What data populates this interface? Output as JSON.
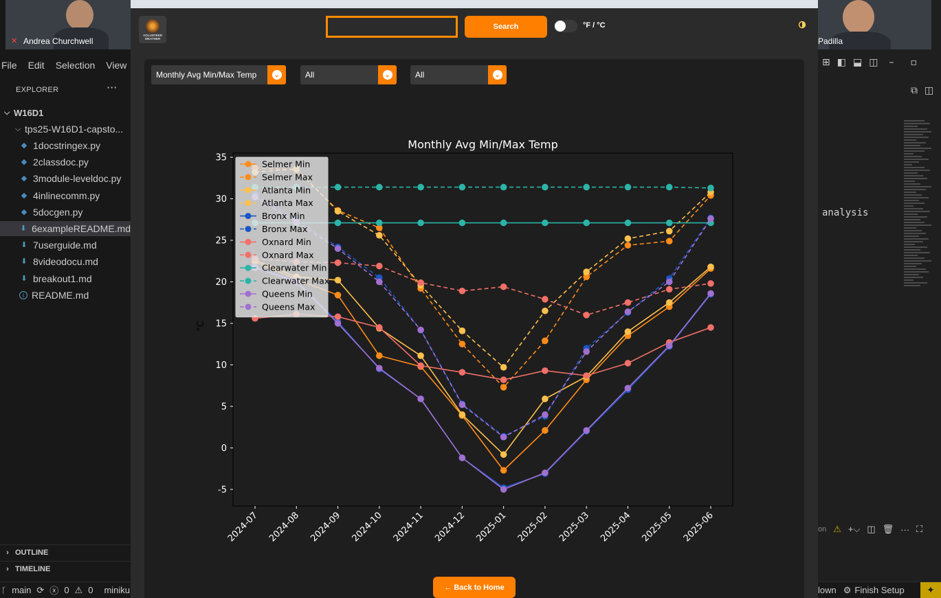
{
  "meeting": {
    "participant_left": "Andrea Churchwell",
    "participant_right": "Padilla"
  },
  "vscode": {
    "menu": [
      "File",
      "Edit",
      "Selection",
      "View"
    ],
    "explorer_title": "EXPLORER",
    "workspace": "W16D1",
    "folder": "tps25-W16D1-capsto...",
    "files": [
      {
        "name": "1docstringex.py",
        "kind": "py"
      },
      {
        "name": "2classdoc.py",
        "kind": "py"
      },
      {
        "name": "3module-leveldoc.py",
        "kind": "py"
      },
      {
        "name": "4inlinecomm.py",
        "kind": "py"
      },
      {
        "name": "5docgen.py",
        "kind": "py"
      },
      {
        "name": "6exampleREADME.md",
        "kind": "md"
      },
      {
        "name": "7userguide.md",
        "kind": "md"
      },
      {
        "name": "8videodocu.md",
        "kind": "md"
      },
      {
        "name": "breakout1.md",
        "kind": "md"
      },
      {
        "name": "README.md",
        "kind": "info"
      }
    ],
    "outline_label": "OUTLINE",
    "timeline_label": "TIMELINE",
    "status": {
      "branch": "main",
      "errors": "0",
      "warnings": "0",
      "extra": "miniku"
    },
    "editor_text": "analysis",
    "right_status": {
      "down": "lown",
      "finish_setup": "Finish Setup",
      "partial": "on"
    }
  },
  "app": {
    "logo_text": "VOLUNTEER WEATHER",
    "search": {
      "value": "",
      "button": "Search"
    },
    "unit_toggle_label": "°F / °C",
    "selects": [
      {
        "value": "Monthly Avg Min/Max Temp"
      },
      {
        "value": "All"
      },
      {
        "value": "All"
      }
    ],
    "back_button": "← Back to Home",
    "colors": {
      "accent": "#ff7f00",
      "background": "#1e1e1e"
    }
  },
  "chart_data": {
    "type": "line",
    "title": "Monthly Avg Min/Max Temp",
    "xlabel": "",
    "ylabel": "°C",
    "ylim": [
      -7,
      35.5
    ],
    "yticks": [
      -5,
      0,
      5,
      10,
      15,
      20,
      25,
      30,
      35
    ],
    "grid": false,
    "legend_placement": "top-left",
    "categories": [
      "2024-07",
      "2024-08",
      "2024-09",
      "2024-10",
      "2024-11",
      "2024-12",
      "2025-01",
      "2025-02",
      "2025-03",
      "2025-04",
      "2025-05",
      "2025-06"
    ],
    "series": [
      {
        "name": "Selmer Min",
        "color": "#ff8c1a",
        "style": "solid",
        "values": [
          22.4,
          20.3,
          18.4,
          11.1,
          9.8,
          3.9,
          -2.7,
          2.1,
          8.2,
          13.5,
          17.0,
          21.6
        ]
      },
      {
        "name": "Selmer Max",
        "color": "#ff8c1a",
        "style": "dashed",
        "values": [
          33.7,
          33.5,
          28.6,
          26.5,
          19.2,
          12.5,
          7.3,
          12.9,
          20.6,
          24.4,
          24.9,
          30.4
        ]
      },
      {
        "name": "Atlanta Min",
        "color": "#ffc04d",
        "style": "solid",
        "values": [
          22.6,
          20.6,
          20.2,
          14.4,
          11.1,
          4.0,
          -0.8,
          5.9,
          8.6,
          14.0,
          17.5,
          21.8
        ]
      },
      {
        "name": "Atlanta Max",
        "color": "#ffc04d",
        "style": "dashed",
        "values": [
          33.2,
          33.6,
          28.5,
          25.6,
          19.6,
          14.1,
          9.7,
          16.5,
          21.2,
          25.2,
          26.1,
          30.8
        ]
      },
      {
        "name": "Bronx Min",
        "color": "#1a56c4",
        "style": "solid",
        "values": [
          21.8,
          20.1,
          15.2,
          9.5,
          5.9,
          -1.2,
          -4.8,
          -3.1,
          2.0,
          7.0,
          12.2,
          18.5
        ]
      },
      {
        "name": "Bronx Max",
        "color": "#1a56c4",
        "style": "dashed",
        "values": [
          30.5,
          27.5,
          24.2,
          20.5,
          14.2,
          5.3,
          1.4,
          3.8,
          12.0,
          16.3,
          20.4,
          27.7
        ]
      },
      {
        "name": "Oxnard Min",
        "color": "#f27068",
        "style": "solid",
        "values": [
          15.6,
          16.1,
          15.8,
          14.5,
          9.9,
          9.1,
          8.2,
          9.3,
          8.7,
          10.2,
          12.7,
          14.5
        ]
      },
      {
        "name": "Oxnard Max",
        "color": "#f27068",
        "style": "dashed",
        "values": [
          22.8,
          22.4,
          22.3,
          21.9,
          19.9,
          18.9,
          19.4,
          17.9,
          16.0,
          17.5,
          19.1,
          19.8
        ]
      },
      {
        "name": "Clearwater Min",
        "color": "#2bb5a8",
        "style": "solid",
        "values": [
          27.1,
          27.1,
          27.1,
          27.1,
          27.1,
          27.1,
          27.1,
          27.1,
          27.1,
          27.1,
          27.1,
          27.1
        ]
      },
      {
        "name": "Clearwater Max",
        "color": "#2bb5a8",
        "style": "dashed",
        "values": [
          31.4,
          31.4,
          31.4,
          31.4,
          31.4,
          31.4,
          31.4,
          31.4,
          31.4,
          31.4,
          31.4,
          31.3
        ]
      },
      {
        "name": "Queens Min",
        "color": "#a070d0",
        "style": "solid",
        "values": [
          21.7,
          20.0,
          15.0,
          9.6,
          5.9,
          -1.2,
          -5.0,
          -3.0,
          2.1,
          7.2,
          12.3,
          18.6
        ]
      },
      {
        "name": "Queens Max",
        "color": "#a070d0",
        "style": "dashed",
        "values": [
          30.2,
          27.2,
          24.0,
          20.0,
          14.2,
          5.2,
          1.3,
          4.0,
          11.6,
          16.4,
          20.0,
          27.6
        ]
      }
    ]
  }
}
